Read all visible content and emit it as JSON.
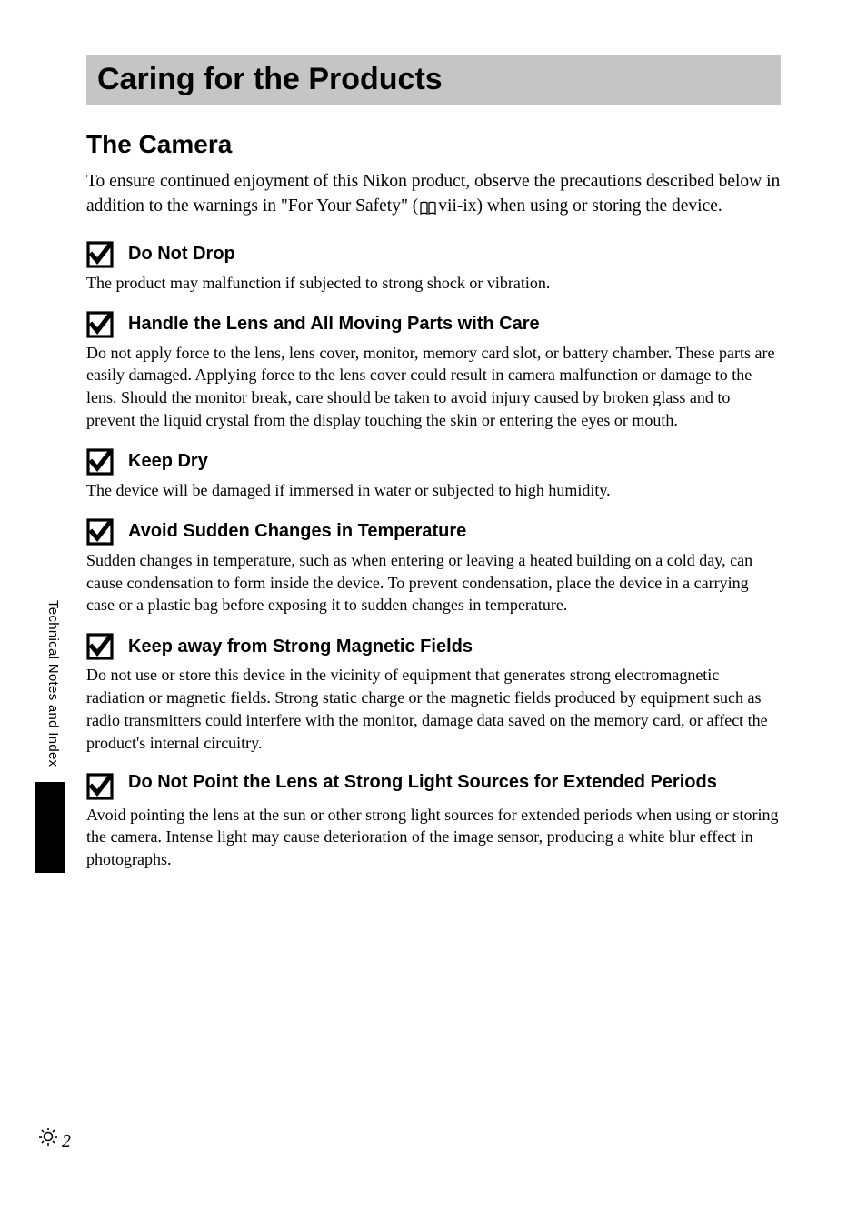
{
  "mainTitle": "Caring for the Products",
  "sectionTitle": "The Camera",
  "introPart1": "To ensure continued enjoyment of this Nikon product, observe the precautions described below in addition to the warnings in \"For Your Safety\" (",
  "introPart2": "vii-ix) when using or storing the device.",
  "callouts": [
    {
      "title": "Do Not Drop",
      "body": "The product may malfunction if subjected to strong shock or vibration."
    },
    {
      "title": "Handle the Lens and All Moving Parts with Care",
      "body": "Do not apply force to the lens, lens cover, monitor, memory card slot, or battery chamber. These parts are easily damaged. Applying force to the lens cover could result in camera malfunction or damage to the lens. Should the monitor break, care should be taken to avoid injury caused by broken glass and to prevent the liquid crystal from the display touching the skin or entering the eyes or mouth."
    },
    {
      "title": "Keep Dry",
      "body": "The device will be damaged if immersed in water or subjected to high humidity."
    },
    {
      "title": "Avoid Sudden Changes in Temperature",
      "body": "Sudden changes in temperature, such as when entering or leaving a heated building on a cold day, can cause condensation to form inside the device. To prevent condensation, place the device in a carrying case or a plastic bag before exposing it to sudden changes in temperature."
    },
    {
      "title": "Keep away from Strong Magnetic Fields",
      "body": "Do not use or store this device in the vicinity of equipment that generates strong electromagnetic radiation or magnetic fields. Strong static charge or the magnetic fields produced by equipment such as radio transmitters could interfere with the monitor, damage data saved on the memory card, or affect the product's internal circuitry."
    },
    {
      "title": "Do Not Point the Lens at Strong Light Sources for Extended Periods",
      "body": "Avoid pointing the lens at the sun or other strong light sources for extended periods when using or storing the camera. Intense light may cause deterioration of the image sensor, producing a white blur effect in photographs."
    }
  ],
  "verticalLabel": "Technical Notes and Index",
  "pageNumber": "2"
}
